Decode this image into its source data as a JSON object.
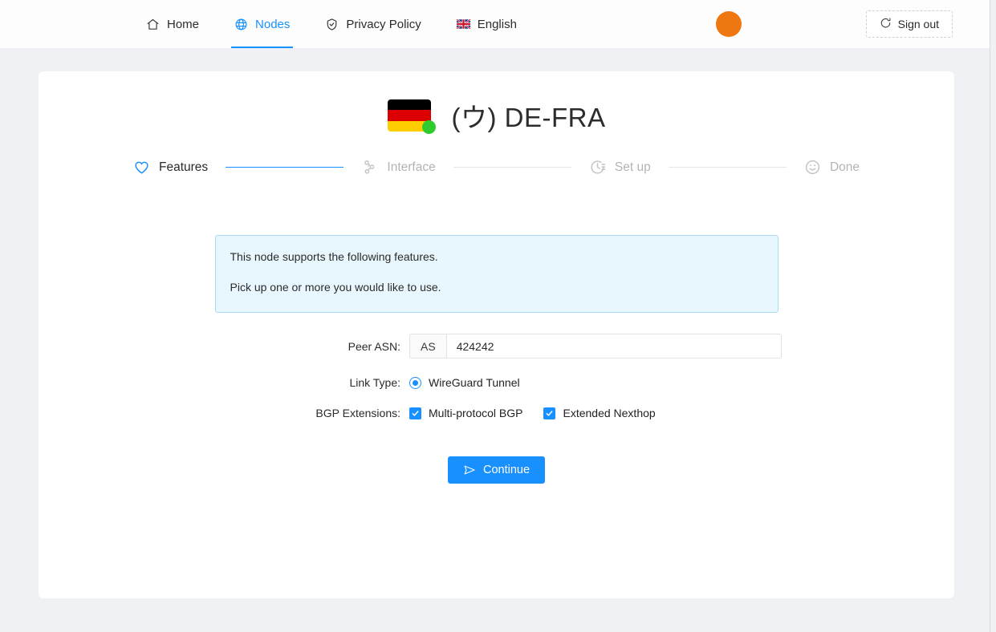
{
  "header": {
    "nav": [
      {
        "label": "Home",
        "icon": "home-icon",
        "active": false
      },
      {
        "label": "Nodes",
        "icon": "globe-icon",
        "active": true
      },
      {
        "label": "Privacy Policy",
        "icon": "shield-check-icon",
        "active": false
      },
      {
        "label": "English",
        "icon": "uk-flag-icon",
        "active": false
      }
    ],
    "avatar_color": "#ee7711",
    "signout_label": "Sign out",
    "signout_icon": "logout-icon"
  },
  "node": {
    "flag": "de-flag-icon",
    "flag_colors": [
      "#000000",
      "#dd0000",
      "#ffce00"
    ],
    "status": "online",
    "status_color": "#2ecc2e",
    "name": "(ウ) DE-FRA"
  },
  "steps": [
    {
      "label": "Features",
      "icon": "heart-icon",
      "state": "active"
    },
    {
      "label": "Interface",
      "icon": "nodes-icon",
      "state": "pending"
    },
    {
      "label": "Set up",
      "icon": "clock-icon",
      "state": "pending"
    },
    {
      "label": "Done",
      "icon": "smiley-icon",
      "state": "pending"
    }
  ],
  "alert": {
    "line1": "This node supports the following features.",
    "line2": "Pick up one or more you would like to use.",
    "bg": "#e8f7fd",
    "border": "#a9dcf2"
  },
  "form": {
    "peer_asn": {
      "label": "Peer ASN:",
      "addon": "AS",
      "value": "424242",
      "placeholder": ""
    },
    "link_type": {
      "label": "Link Type:",
      "options": [
        {
          "label": "WireGuard Tunnel",
          "selected": true
        }
      ]
    },
    "bgp_extensions": {
      "label": "BGP Extensions:",
      "options": [
        {
          "label": "Multi-protocol BGP",
          "checked": true
        },
        {
          "label": "Extended Nexthop",
          "checked": true
        }
      ]
    },
    "submit": {
      "label": "Continue",
      "icon": "send-icon",
      "color": "#1890ff"
    }
  },
  "theme": {
    "accent": "#1890ff",
    "page_bg": "#f0f1f4",
    "card_bg": "#ffffff"
  }
}
